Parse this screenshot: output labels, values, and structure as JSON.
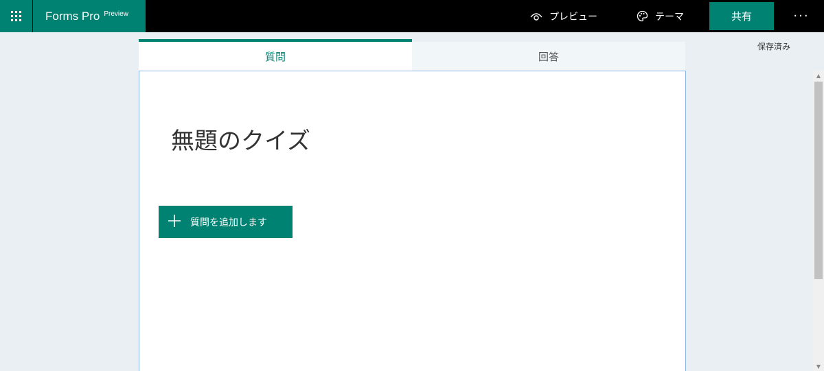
{
  "app": {
    "name": "Forms Pro",
    "tag": "Preview"
  },
  "toolbar": {
    "preview_label": "プレビュー",
    "theme_label": "テーマ",
    "share_label": "共有",
    "more_label": "···"
  },
  "status": {
    "saved": "保存済み"
  },
  "tabs": [
    {
      "label": "質問",
      "selected": true
    },
    {
      "label": "回答",
      "selected": false
    }
  ],
  "form": {
    "title": "無題のクイズ",
    "add_question_label": "質問を追加します"
  },
  "icons": {
    "app_launcher": "waffle-icon",
    "preview": "eye-icon",
    "theme": "palette-icon",
    "add": "plus-icon"
  },
  "colors": {
    "accent": "#008272",
    "topbar": "#000000",
    "background": "#e9eff2"
  }
}
